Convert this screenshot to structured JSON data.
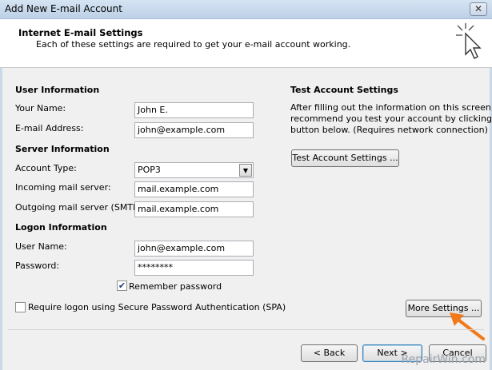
{
  "window": {
    "title": "Add New E-mail Account",
    "close_glyph": "✕"
  },
  "header": {
    "title": "Internet E-mail Settings",
    "subtitle": "Each of these settings are required to get your e-mail account working."
  },
  "user_info": {
    "heading": "User Information",
    "name_label": "Your Name:",
    "name_value": "John E.",
    "email_label": "E-mail Address:",
    "email_value": "john@example.com"
  },
  "server_info": {
    "heading": "Server Information",
    "account_type_label": "Account Type:",
    "account_type_value": "POP3",
    "incoming_label": "Incoming mail server:",
    "incoming_value": "mail.example.com",
    "outgoing_label": "Outgoing mail server (SMTP):",
    "outgoing_value": "mail.example.com"
  },
  "logon_info": {
    "heading": "Logon Information",
    "username_label": "User Name:",
    "username_value": "john@example.com",
    "password_label": "Password:",
    "password_value": "********",
    "remember_label": "Remember password",
    "remember_checked": true,
    "spa_label": "Require logon using Secure Password Authentication (SPA)",
    "spa_checked": false
  },
  "test_settings": {
    "heading": "Test Account Settings",
    "description": [
      "After filling out the information on this screen, we",
      "recommend you test your account by clicking the",
      "button below. (Requires network connection)"
    ],
    "test_button": "Test Account Settings ..."
  },
  "buttons": {
    "more_settings": "More Settings ...",
    "back": "< Back",
    "next": "Next >",
    "cancel": "Cancel"
  },
  "watermark": "RepairWin.com",
  "colors": {
    "annotation_arrow": "#f07a1a"
  }
}
